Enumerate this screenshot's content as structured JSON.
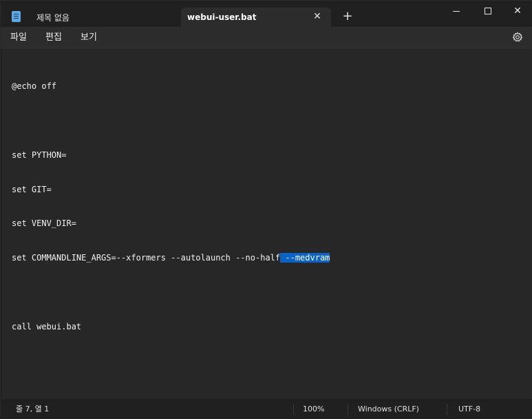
{
  "tabs": [
    {
      "label": "제목 없음",
      "active": false
    },
    {
      "label": "webui-user.bat",
      "active": true
    }
  ],
  "menu": {
    "file": "파일",
    "edit": "편집",
    "view": "보기"
  },
  "editor": {
    "lines": [
      "@echo off",
      "",
      "set PYTHON=",
      "set GIT=",
      "set VENV_DIR=",
      "set COMMANDLINE_ARGS=--xformers --autolaunch --no-half",
      "",
      "call webui.bat"
    ],
    "selected_text": " --medvram",
    "selection_line": 5
  },
  "status": {
    "position": "줄 7, 열 1",
    "zoom": "100%",
    "line_ending": "Windows (CRLF)",
    "encoding": "UTF-8"
  },
  "colors": {
    "selection": "#0a64c8",
    "editor_bg": "#272727",
    "chrome_bg": "#202020"
  },
  "icons": {
    "app": "notepad-icon",
    "tab_close": "close-icon",
    "new_tab": "plus-icon",
    "minimize": "minimize-icon",
    "maximize": "maximize-icon",
    "close": "close-icon",
    "settings": "gear-icon"
  }
}
